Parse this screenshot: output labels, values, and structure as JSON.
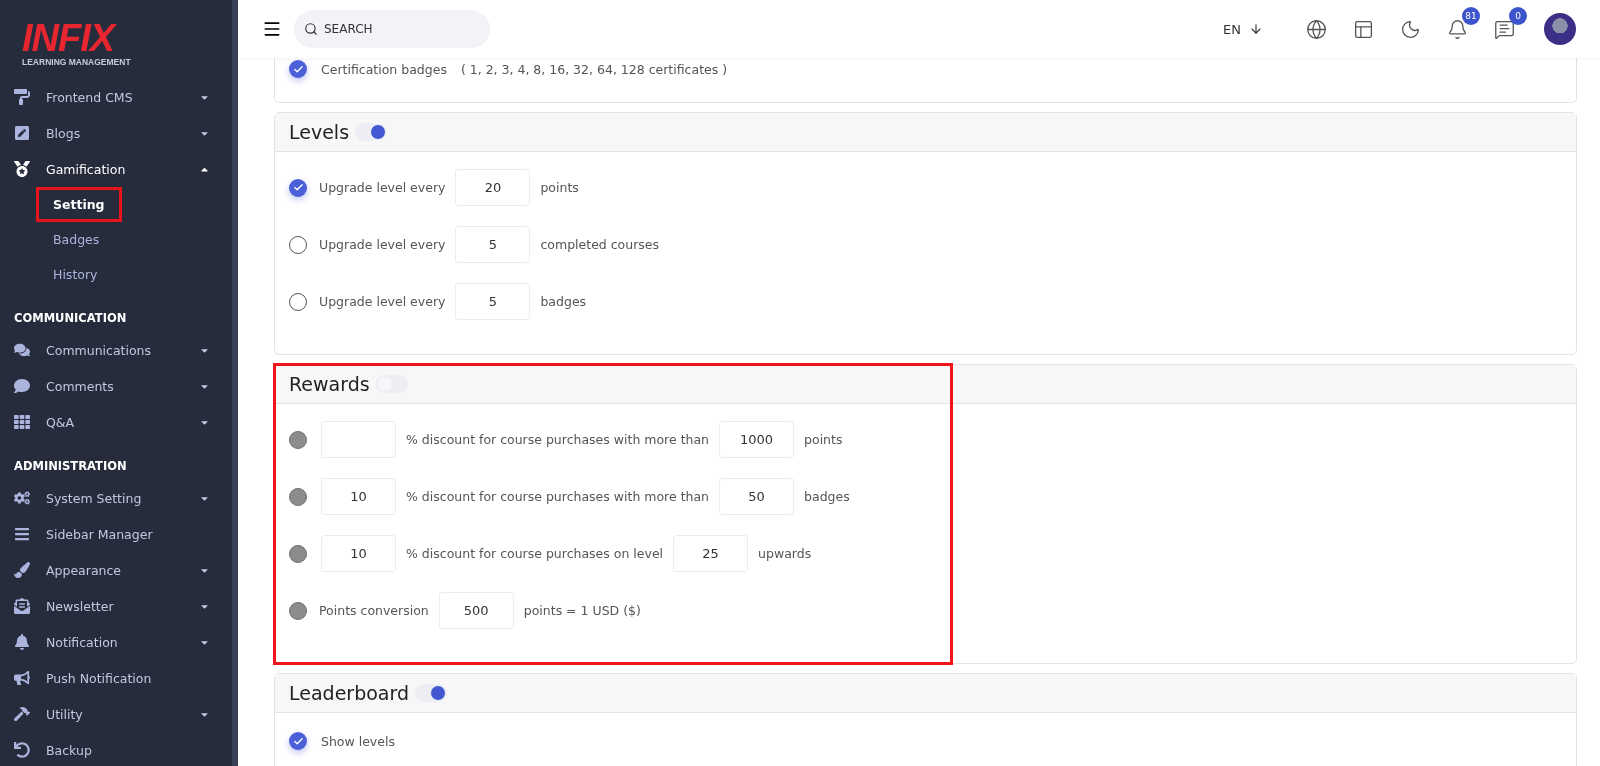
{
  "sidebar": {
    "logo": {
      "mark": "INFIX",
      "tagline": "LEARNING MANAGEMENT"
    },
    "groups": [
      {
        "items": [
          {
            "label": "Frontend CMS",
            "kind": "dropdown",
            "expanded": false
          },
          {
            "label": "Blogs",
            "kind": "dropdown",
            "expanded": false
          },
          {
            "label": "Gamification",
            "kind": "dropdown",
            "expanded": true,
            "children": [
              {
                "label": "Setting",
                "selected": true,
                "highlighted": true
              },
              {
                "label": "Badges",
                "selected": false,
                "highlighted": false
              },
              {
                "label": "History",
                "selected": false,
                "highlighted": false
              }
            ]
          }
        ]
      },
      {
        "heading": "COMMUNICATION",
        "items": [
          {
            "label": "Communications",
            "kind": "dropdown",
            "expanded": false
          },
          {
            "label": "Comments",
            "kind": "dropdown",
            "expanded": false
          },
          {
            "label": "Q&A",
            "kind": "dropdown",
            "expanded": false
          }
        ]
      },
      {
        "heading": "ADMINISTRATION",
        "items": [
          {
            "label": "System Setting",
            "kind": "dropdown",
            "expanded": false
          },
          {
            "label": "Sidebar Manager",
            "kind": "link"
          },
          {
            "label": "Appearance",
            "kind": "dropdown",
            "expanded": false
          },
          {
            "label": "Newsletter",
            "kind": "dropdown",
            "expanded": false
          },
          {
            "label": "Notification",
            "kind": "dropdown",
            "expanded": false
          },
          {
            "label": "Push Notification",
            "kind": "link"
          },
          {
            "label": "Utility",
            "kind": "dropdown",
            "expanded": false
          },
          {
            "label": "Backup",
            "kind": "link"
          }
        ]
      }
    ]
  },
  "header": {
    "search": {
      "placeholder": "SEARCH"
    },
    "language": "EN",
    "notifications_count": "81",
    "messages_count": "0"
  },
  "sections": [
    {
      "kind": "checklist",
      "highlighted": false,
      "items": [
        {
          "label": "Certification badges",
          "note": "( 1, 2, 3, 4, 8, 16, 32, 64, 128 certificates )",
          "checked": true
        }
      ]
    },
    {
      "kind": "radio",
      "title": "Levels",
      "on": true,
      "highlighted": false,
      "rows": [
        {
          "selected": true,
          "parts": [
            {
              "kind": "text",
              "text": "Upgrade level every"
            },
            {
              "kind": "input",
              "value": "20"
            },
            {
              "kind": "text",
              "text": "points"
            }
          ]
        },
        {
          "selected": false,
          "parts": [
            {
              "kind": "text",
              "text": "Upgrade level every"
            },
            {
              "kind": "input",
              "value": "5"
            },
            {
              "kind": "text",
              "text": "completed courses"
            }
          ]
        },
        {
          "selected": false,
          "parts": [
            {
              "kind": "text",
              "text": "Upgrade level every"
            },
            {
              "kind": "input",
              "value": "5"
            },
            {
              "kind": "text",
              "text": "badges"
            }
          ]
        }
      ]
    },
    {
      "kind": "radio",
      "title": "Rewards",
      "on": false,
      "highlighted": true,
      "rows": [
        {
          "selected": false,
          "parts": [
            {
              "kind": "input"
            },
            {
              "kind": "text",
              "text": "% discount for course purchases with more than"
            },
            {
              "kind": "input",
              "value": "1000"
            },
            {
              "kind": "text",
              "text": "points"
            }
          ]
        },
        {
          "selected": false,
          "parts": [
            {
              "kind": "input",
              "value": "10"
            },
            {
              "kind": "text",
              "text": "% discount for course purchases with more than"
            },
            {
              "kind": "input",
              "value": "50"
            },
            {
              "kind": "text",
              "text": "badges"
            }
          ]
        },
        {
          "selected": false,
          "parts": [
            {
              "kind": "input",
              "value": "10"
            },
            {
              "kind": "text",
              "text": "% discount for course purchases on level"
            },
            {
              "kind": "input",
              "value": "25"
            },
            {
              "kind": "text",
              "text": "upwards"
            }
          ]
        },
        {
          "selected": false,
          "parts": [
            {
              "kind": "text",
              "text": "Points conversion"
            },
            {
              "kind": "input",
              "value": "500"
            },
            {
              "kind": "text",
              "text": "points = 1 USD ($)"
            }
          ]
        }
      ]
    },
    {
      "kind": "checklist",
      "title": "Leaderboard",
      "on": true,
      "highlighted": false,
      "items": [
        {
          "label": "Show levels",
          "checked": true
        }
      ]
    }
  ]
}
